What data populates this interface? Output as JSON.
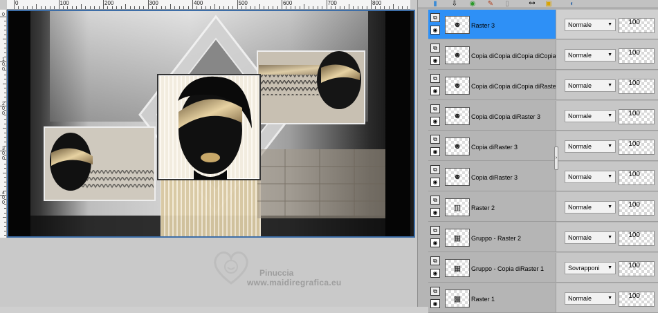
{
  "ruler": {
    "h_labels": [
      "0",
      "100",
      "200",
      "300",
      "400",
      "500",
      "600",
      "700",
      "800"
    ],
    "v_labels": [
      "0",
      "1 0 0",
      "2 0 0",
      "3 0 0",
      "4 0 0"
    ]
  },
  "watermark": {
    "name": "Pinuccia",
    "url": "www.maidiregrafica.eu"
  },
  "toolbar": {
    "icons": [
      "new-layer-icon",
      "arrow-down-icon",
      "mask-icon",
      "brush-icon",
      "delete-icon",
      "link-icon",
      "lock-icon",
      "help-icon"
    ]
  },
  "layers": [
    {
      "name": "Raster 3",
      "blend": "Normale",
      "opacity": "100",
      "selected": true,
      "thumb_icon": "face-icon"
    },
    {
      "name": "Copia diCopia diCopia diCopia",
      "blend": "Normale",
      "opacity": "100",
      "selected": false,
      "thumb_icon": "face-icon"
    },
    {
      "name": "Copia diCopia diCopia diRaster",
      "blend": "Normale",
      "opacity": "100",
      "selected": false,
      "thumb_icon": "face-icon"
    },
    {
      "name": "Copia diCopia diRaster 3",
      "blend": "Normale",
      "opacity": "100",
      "selected": false,
      "thumb_icon": "face-icon"
    },
    {
      "name": "Copia diRaster 3",
      "blend": "Normale",
      "opacity": "100",
      "selected": false,
      "thumb_icon": "face-icon"
    },
    {
      "name": "Copia diRaster 3",
      "blend": "Normale",
      "opacity": "100",
      "selected": false,
      "thumb_icon": "face-icon"
    },
    {
      "name": "Raster 2",
      "blend": "Normale",
      "opacity": "100",
      "selected": false,
      "thumb_icon": "columns-icon"
    },
    {
      "name": "Gruppo - Raster 2",
      "blend": "Normale",
      "opacity": "100",
      "selected": false,
      "thumb_icon": "group-icon"
    },
    {
      "name": "Gruppo - Copia diRaster 1",
      "blend": "Sovrapponi",
      "opacity": "100",
      "selected": false,
      "thumb_icon": "group-icon"
    },
    {
      "name": "Raster 1",
      "blend": "Normale",
      "opacity": "100",
      "selected": false,
      "thumb_icon": "image-icon"
    }
  ],
  "colors": {
    "selection": "#2e90f6",
    "frame": "#3d6ea8",
    "gold": "#b49a6a"
  }
}
